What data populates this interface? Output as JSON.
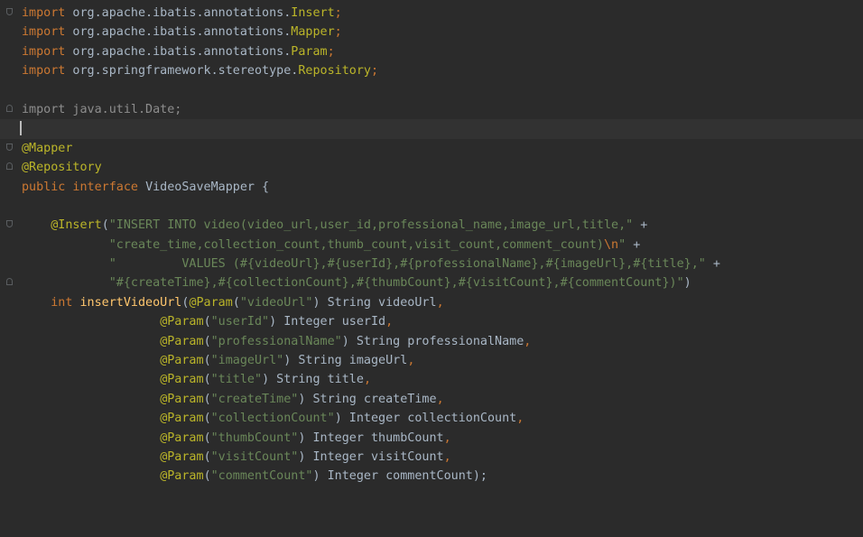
{
  "editor": {
    "lines": [
      {
        "fold": "open",
        "tokens": [
          [
            "kw",
            "import"
          ],
          [
            "plain",
            " org.apache.ibatis.annotations."
          ],
          [
            "ann",
            "Insert"
          ],
          [
            "kw",
            ";"
          ]
        ]
      },
      {
        "fold": "",
        "tokens": [
          [
            "kw",
            "import"
          ],
          [
            "plain",
            " org.apache.ibatis.annotations."
          ],
          [
            "ann",
            "Mapper"
          ],
          [
            "kw",
            ";"
          ]
        ]
      },
      {
        "fold": "",
        "tokens": [
          [
            "kw",
            "import"
          ],
          [
            "plain",
            " org.apache.ibatis.annotations."
          ],
          [
            "ann",
            "Param"
          ],
          [
            "kw",
            ";"
          ]
        ]
      },
      {
        "fold": "",
        "tokens": [
          [
            "kw",
            "import"
          ],
          [
            "plain",
            " org.springframework.stereotype."
          ],
          [
            "ann",
            "Repository"
          ],
          [
            "kw",
            ";"
          ]
        ]
      },
      {
        "fold": "",
        "tokens": []
      },
      {
        "fold": "close",
        "tokens": [
          [
            "dim",
            "import java.util.Date;"
          ]
        ]
      },
      {
        "fold": "",
        "current": true,
        "caret": true,
        "tokens": []
      },
      {
        "fold": "open",
        "tokens": [
          [
            "ann",
            "@Mapper"
          ]
        ]
      },
      {
        "fold": "close",
        "tokens": [
          [
            "ann",
            "@Repository"
          ]
        ]
      },
      {
        "fold": "",
        "tokens": [
          [
            "kw",
            "public interface "
          ],
          [
            "plain",
            "VideoSaveMapper {"
          ]
        ]
      },
      {
        "fold": "",
        "tokens": []
      },
      {
        "fold": "open",
        "tokens": [
          [
            "plain",
            "    "
          ],
          [
            "ann",
            "@Insert"
          ],
          [
            "plain",
            "("
          ],
          [
            "str",
            "\"INSERT INTO video(video_url,user_id,professional_name,image_url,title,\""
          ],
          [
            "plain",
            " +"
          ]
        ]
      },
      {
        "fold": "",
        "tokens": [
          [
            "plain",
            "            "
          ],
          [
            "str",
            "\"create_time,collection_count,thumb_count,visit_count,comment_count)"
          ],
          [
            "esc",
            "\\n"
          ],
          [
            "str",
            "\""
          ],
          [
            "plain",
            " +"
          ]
        ]
      },
      {
        "fold": "",
        "tokens": [
          [
            "plain",
            "            "
          ],
          [
            "str",
            "\"         VALUES (#{videoUrl},#{userId},#{professionalName},#{imageUrl},#{title},\""
          ],
          [
            "plain",
            " +"
          ]
        ]
      },
      {
        "fold": "close",
        "tokens": [
          [
            "plain",
            "            "
          ],
          [
            "str",
            "\"#{createTime},#{collectionCount},#{thumbCount},#{visitCount},#{commentCount})\""
          ],
          [
            "plain",
            ")"
          ]
        ]
      },
      {
        "fold": "",
        "tokens": [
          [
            "plain",
            "    "
          ],
          [
            "kw",
            "int "
          ],
          [
            "fn",
            "insertVideoUrl"
          ],
          [
            "plain",
            "("
          ],
          [
            "ann",
            "@Param"
          ],
          [
            "plain",
            "("
          ],
          [
            "str",
            "\"videoUrl\""
          ],
          [
            "plain",
            ") String videoUrl"
          ],
          [
            "kw",
            ","
          ]
        ]
      },
      {
        "fold": "",
        "tokens": [
          [
            "plain",
            "                   "
          ],
          [
            "ann",
            "@Param"
          ],
          [
            "plain",
            "("
          ],
          [
            "str",
            "\"userId\""
          ],
          [
            "plain",
            ") Integer userId"
          ],
          [
            "kw",
            ","
          ]
        ]
      },
      {
        "fold": "",
        "tokens": [
          [
            "plain",
            "                   "
          ],
          [
            "ann",
            "@Param"
          ],
          [
            "plain",
            "("
          ],
          [
            "str",
            "\"professionalName\""
          ],
          [
            "plain",
            ") String professionalName"
          ],
          [
            "kw",
            ","
          ]
        ]
      },
      {
        "fold": "",
        "tokens": [
          [
            "plain",
            "                   "
          ],
          [
            "ann",
            "@Param"
          ],
          [
            "plain",
            "("
          ],
          [
            "str",
            "\"imageUrl\""
          ],
          [
            "plain",
            ") String imageUrl"
          ],
          [
            "kw",
            ","
          ]
        ]
      },
      {
        "fold": "",
        "tokens": [
          [
            "plain",
            "                   "
          ],
          [
            "ann",
            "@Param"
          ],
          [
            "plain",
            "("
          ],
          [
            "str",
            "\"title\""
          ],
          [
            "plain",
            ") String title"
          ],
          [
            "kw",
            ","
          ]
        ]
      },
      {
        "fold": "",
        "tokens": [
          [
            "plain",
            "                   "
          ],
          [
            "ann",
            "@Param"
          ],
          [
            "plain",
            "("
          ],
          [
            "str",
            "\"createTime\""
          ],
          [
            "plain",
            ") String createTime"
          ],
          [
            "kw",
            ","
          ]
        ]
      },
      {
        "fold": "",
        "tokens": [
          [
            "plain",
            "                   "
          ],
          [
            "ann",
            "@Param"
          ],
          [
            "plain",
            "("
          ],
          [
            "str",
            "\"collectionCount\""
          ],
          [
            "plain",
            ") Integer collectionCount"
          ],
          [
            "kw",
            ","
          ]
        ]
      },
      {
        "fold": "",
        "tokens": [
          [
            "plain",
            "                   "
          ],
          [
            "ann",
            "@Param"
          ],
          [
            "plain",
            "("
          ],
          [
            "str",
            "\"thumbCount\""
          ],
          [
            "plain",
            ") Integer thumbCount"
          ],
          [
            "kw",
            ","
          ]
        ]
      },
      {
        "fold": "",
        "tokens": [
          [
            "plain",
            "                   "
          ],
          [
            "ann",
            "@Param"
          ],
          [
            "plain",
            "("
          ],
          [
            "str",
            "\"visitCount\""
          ],
          [
            "plain",
            ") Integer visitCount"
          ],
          [
            "kw",
            ","
          ]
        ]
      },
      {
        "fold": "",
        "tokens": [
          [
            "plain",
            "                   "
          ],
          [
            "ann",
            "@Param"
          ],
          [
            "plain",
            "("
          ],
          [
            "str",
            "\"commentCount\""
          ],
          [
            "plain",
            ") Integer commentCount);"
          ]
        ]
      }
    ]
  }
}
